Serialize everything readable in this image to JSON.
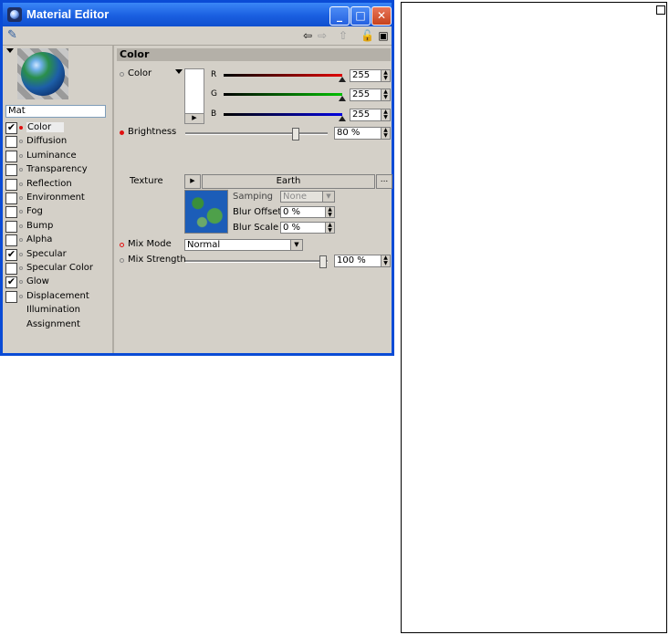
{
  "window": {
    "title": "Material Editor",
    "minimize": "_",
    "maximize": "□",
    "close": "✕"
  },
  "toolbar": {
    "icons": [
      "pin-icon",
      "back-arrow-icon",
      "forward-arrow-icon",
      "up-arrow-icon",
      "lock-icon",
      "window-icon"
    ]
  },
  "material": {
    "name": "Mat"
  },
  "channels": [
    {
      "label": "Color",
      "checked": true,
      "dot": "red"
    },
    {
      "label": "Diffusion",
      "checked": false
    },
    {
      "label": "Luminance",
      "checked": false
    },
    {
      "label": "Transparency",
      "checked": false
    },
    {
      "label": "Reflection",
      "checked": false
    },
    {
      "label": "Environment",
      "checked": false
    },
    {
      "label": "Fog",
      "checked": false
    },
    {
      "label": "Bump",
      "checked": false
    },
    {
      "label": "Alpha",
      "checked": false
    },
    {
      "label": "Specular",
      "checked": true
    },
    {
      "label": "Specular Color",
      "checked": false
    },
    {
      "label": "Glow",
      "checked": true
    },
    {
      "label": "Displacement",
      "checked": false
    }
  ],
  "extra_items": [
    "Illumination",
    "Assignment"
  ],
  "color_group": {
    "title": "Color",
    "color_label": "Color",
    "r_label": "R",
    "g_label": "G",
    "b_label": "B",
    "r_value": "255",
    "g_value": "255",
    "b_value": "255",
    "brightness_label": "Brightness",
    "brightness_value": "80 %",
    "brightness_level": 0.8,
    "texture_label": "Texture",
    "texture_name": "Earth",
    "texture_more": "...",
    "sampling_label": "Samping",
    "sampling_value": "None",
    "blur_offset_label": "Blur Offset",
    "blur_offset_value": "0 %",
    "blur_scale_label": "Blur Scale",
    "blur_scale_value": "0 %",
    "mix_mode_label": "Mix Mode",
    "mix_mode_value": "Normal",
    "mix_strength_label": "Mix Strength",
    "mix_strength_value": "100 %",
    "mix_strength_level": 1.0
  },
  "colors": {
    "title_bar": "#1a5fe0",
    "panel": "#d4d0c8",
    "accent_red": "#e01010"
  }
}
